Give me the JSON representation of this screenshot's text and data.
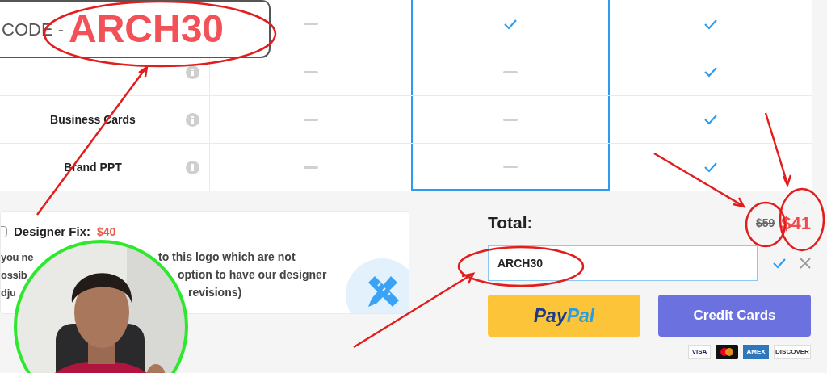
{
  "features": [
    {
      "info": false,
      "cells": [
        {
          "included": false
        },
        {
          "included": true
        },
        {
          "included": true
        }
      ]
    },
    {
      "info": true,
      "cells": [
        {
          "included": false
        },
        {
          "included": false
        },
        {
          "included": true
        }
      ]
    },
    {
      "label": "Business Cards",
      "info": true,
      "cells": [
        {
          "included": false
        },
        {
          "included": false
        },
        {
          "included": true
        }
      ]
    },
    {
      "label": "Brand PPT",
      "info": true,
      "cells": [
        {
          "included": false
        },
        {
          "included": false
        },
        {
          "included": true
        }
      ]
    }
  ],
  "overlay": {
    "prefix": "CODE -",
    "code": "ARCH30"
  },
  "addon": {
    "checked": false,
    "title": "Designer Fix:",
    "price": "$40",
    "lines": [
      {
        "left": "you ne",
        "right": "to this logo which are not"
      },
      {
        "left": "ossib",
        "right": "option to have our designer"
      },
      {
        "left": "dju",
        "right": "revisions)"
      }
    ]
  },
  "checkout": {
    "total_label": "Total:",
    "old_price": "$59",
    "new_price": "$41",
    "coupon_value": "ARCH30",
    "paypal": {
      "first": "Pay",
      "second": "Pal"
    },
    "card_button": "Credit Cards",
    "card_logos": [
      "VISA",
      "AMEX",
      "DISCOVER"
    ]
  }
}
